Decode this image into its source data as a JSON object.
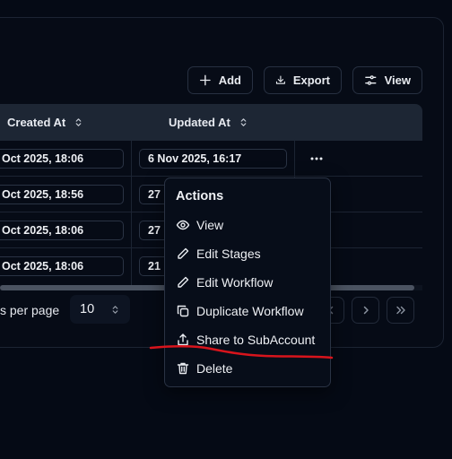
{
  "toolbar": {
    "add_label": "Add",
    "export_label": "Export",
    "view_label": "View"
  },
  "table": {
    "columns": [
      "Created At",
      "Updated At"
    ],
    "rows": [
      {
        "created": "Oct 2025, 18:06",
        "updated": "6 Nov 2025, 16:17"
      },
      {
        "created": "Oct 2025, 18:56",
        "updated": "27"
      },
      {
        "created": "Oct 2025, 18:06",
        "updated": "27"
      },
      {
        "created": "Oct 2025, 18:06",
        "updated": "21"
      }
    ]
  },
  "pagination": {
    "rows_per_page_label": "s per page",
    "rows_per_page_value": "10"
  },
  "menu": {
    "title": "Actions",
    "items": [
      {
        "label": "View",
        "icon": "eye-icon"
      },
      {
        "label": "Edit Stages",
        "icon": "pencil-icon"
      },
      {
        "label": "Edit Workflow",
        "icon": "pencil-icon"
      },
      {
        "label": "Duplicate Workflow",
        "icon": "copy-icon"
      },
      {
        "label": "Share to SubAccount",
        "icon": "share-icon"
      },
      {
        "label": "Delete",
        "icon": "trash-icon"
      }
    ]
  },
  "colors": {
    "background": "#050a15",
    "header_bg": "#1d2634",
    "border": "#2a3344",
    "annotation": "#d8141c"
  }
}
